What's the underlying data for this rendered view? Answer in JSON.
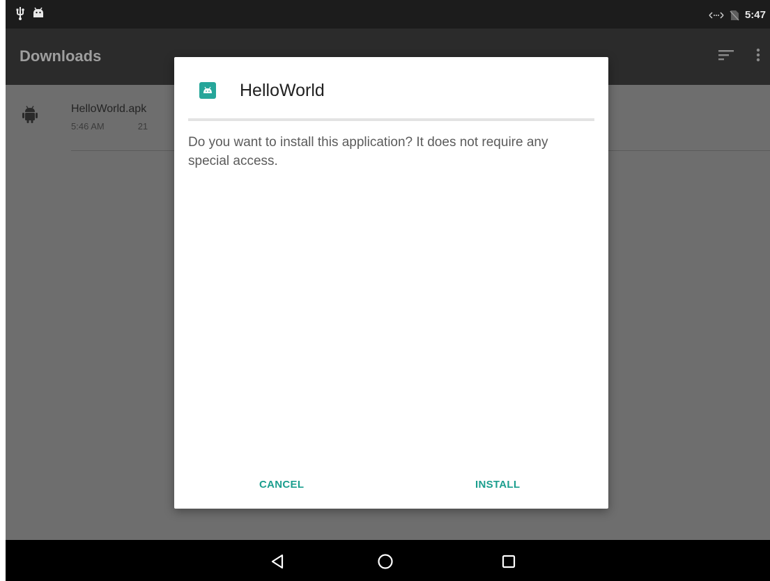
{
  "status_bar": {
    "left_icons": [
      "usb-icon",
      "android-debug-icon"
    ],
    "right_icons": [
      "data-transfer-icon",
      "no-sim-icon"
    ],
    "time": "5:47"
  },
  "app_bar": {
    "title": "Downloads",
    "actions": [
      "sort-icon",
      "overflow-menu-icon"
    ]
  },
  "downloads": [
    {
      "name": "HelloWorld.apk",
      "time": "5:46 AM",
      "size_partial": "21",
      "icon": "android-icon"
    }
  ],
  "dialog": {
    "title": "HelloWorld",
    "icon": "android-app-icon",
    "message": "Do you want to install this application? It does not require any special access.",
    "cancel_label": "CANCEL",
    "install_label": "INSTALL",
    "accent": "#1b9e8e"
  },
  "nav_bar": {
    "buttons": [
      "back-icon",
      "home-icon",
      "recents-icon"
    ]
  },
  "colors": {
    "status_bar": "#1c1c1c",
    "app_bar": "#2b2b2b",
    "scrim": "#6e6e6e",
    "dialog_icon_bg": "#26a69a"
  }
}
